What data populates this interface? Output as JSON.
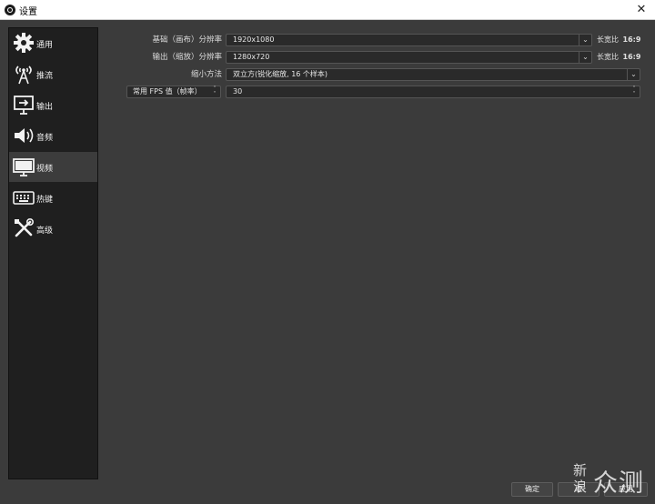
{
  "window": {
    "title": "设置",
    "close_glyph": "✕"
  },
  "sidebar": {
    "items": [
      {
        "label": "通用",
        "icon": "gear-icon"
      },
      {
        "label": "推流",
        "icon": "broadcast-antenna-icon"
      },
      {
        "label": "输出",
        "icon": "output-monitor-icon"
      },
      {
        "label": "音频",
        "icon": "speaker-icon"
      },
      {
        "label": "视频",
        "icon": "monitor-icon",
        "selected": true
      },
      {
        "label": "热键",
        "icon": "keyboard-icon"
      },
      {
        "label": "高级",
        "icon": "tools-icon"
      }
    ]
  },
  "video": {
    "base_resolution": {
      "label": "基础（画布）分辨率",
      "value": "1920x1080",
      "ratio_label": "长宽比",
      "ratio_value": "16:9"
    },
    "output_resolution": {
      "label": "输出（缩放）分辨率",
      "value": "1280x720",
      "ratio_label": "长宽比",
      "ratio_value": "16:9"
    },
    "downscale_filter": {
      "label": "缩小方法",
      "value": "双立方(锐化缩放, 16 个样本)"
    },
    "fps": {
      "type_label": "常用 FPS 值（帧率）",
      "value": "30"
    }
  },
  "footer": {
    "ok_label": "确定",
    "cancel_label": "取",
    "apply_label": "应用"
  },
  "watermark": {
    "line1": "新",
    "line2": "浪",
    "brand": "众测"
  },
  "colors": {
    "accent_monitor": "#8ab4f8",
    "panel": "#3b3b3b",
    "sidebar": "#1f1f1f"
  }
}
